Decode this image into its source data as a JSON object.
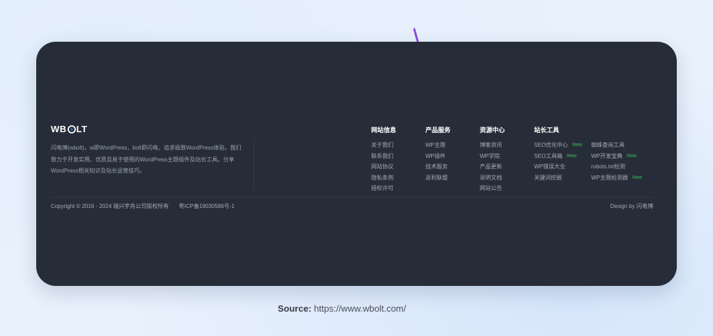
{
  "logo": {
    "part1": "WB",
    "part2": "LT"
  },
  "description": "闪电博(wbolt)，w即WordPress，bolt即闪电，追求极致WordPress体验。我们致力于开发实用、优质且易于使用的WordPress主题插件及站长工具。分享WordPress相关知识及站长运营技巧。",
  "columns": [
    {
      "heading": "网站信息",
      "links": [
        "关于我们",
        "联系我们",
        "网站协议",
        "隐私条例",
        "授权许可"
      ]
    },
    {
      "heading": "产品服务",
      "links": [
        "WP主题",
        "WP插件",
        "技术服务",
        "返利联盟"
      ]
    },
    {
      "heading": "资源中心",
      "links": [
        "博客资讯",
        "WP学院",
        "产品更新",
        "说明文档",
        "网站公告"
      ]
    }
  ],
  "tools": {
    "heading": "站长工具",
    "new_label": "New",
    "left": [
      {
        "label": "SEO优化中心",
        "is_new": true
      },
      {
        "label": "SEO工具箱",
        "is_new": true
      },
      {
        "label": "WP错误大全",
        "is_new": false
      },
      {
        "label": "关键词挖掘",
        "is_new": false
      }
    ],
    "right": [
      {
        "label": "蜘蛛查询工具",
        "is_new": false
      },
      {
        "label": "WP开发宝典",
        "is_new": true
      },
      {
        "label": "robots.txt检测",
        "is_new": false
      },
      {
        "label": "WP主题检测器",
        "is_new": true
      }
    ]
  },
  "footer": {
    "copyright": "Copyright © 2016 - 2024 瑞兴宇舟公司版权所有",
    "icp": "粤ICP备19030586号-1",
    "design_by": "Design by 闪电博"
  },
  "source": {
    "label": "Source:",
    "url": "https://www.wbolt.com/"
  },
  "colors": {
    "card_bg": "#262d38",
    "new_badge": "#3fbf56",
    "logo_bolt": "#2f7cf6",
    "accent": "#8c4bd8"
  }
}
